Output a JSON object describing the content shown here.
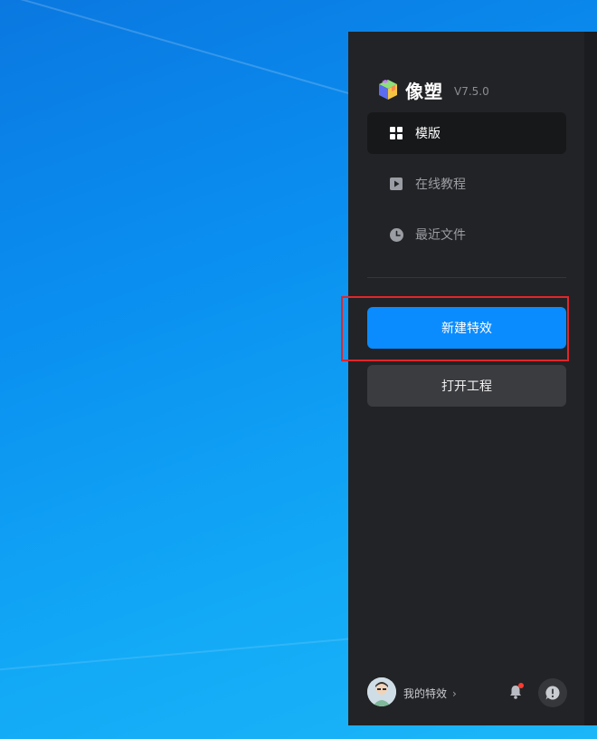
{
  "app": {
    "name": "像塑",
    "version": "V7.5.0",
    "logo_icon": "cube-logo-icon"
  },
  "nav": {
    "items": [
      {
        "label": "模版",
        "icon": "grid-icon",
        "active": true
      },
      {
        "label": "在线教程",
        "icon": "play-icon",
        "active": false
      },
      {
        "label": "最近文件",
        "icon": "clock-icon",
        "active": false
      }
    ]
  },
  "actions": {
    "new_effect": "新建特效",
    "open_project": "打开工程"
  },
  "footer": {
    "my_effects": "我的特效",
    "chevron": "›",
    "avatar_icon": "avatar",
    "bell_icon": "bell-icon",
    "feedback_icon": "feedback-icon"
  },
  "colors": {
    "accent": "#0a8cff",
    "sidebar_bg": "#222326",
    "highlight": "#e0262b",
    "badge": "#ff3b30"
  }
}
